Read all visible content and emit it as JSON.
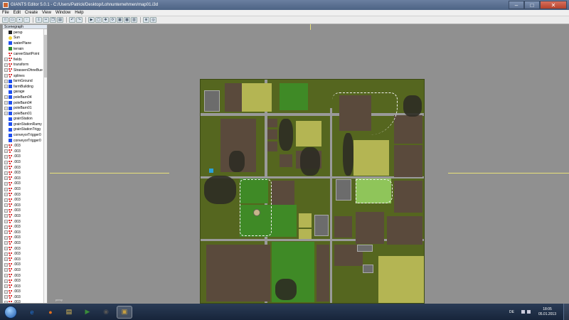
{
  "window": {
    "title": "GIANTS Editor 5.0.1 - C:/Users/Patrick/Desktop/Lohnunternehmen/map01.i3d"
  },
  "menu": [
    "File",
    "Edit",
    "Create",
    "View",
    "Window",
    "Help"
  ],
  "toolbar": {
    "icons": [
      "new-icon",
      "open-icon",
      "save-icon",
      "save-as-icon",
      "import-icon",
      "cut-icon",
      "copy-icon",
      "paste-icon",
      "undo-icon",
      "redo-icon",
      "play-icon",
      "select-icon",
      "move-icon",
      "rotate-icon",
      "terrain-paint-icon",
      "foliage-icon",
      "texture-icon",
      "zoom-icon",
      "camera-icon"
    ]
  },
  "scenegraph": {
    "header": "Scenegraph",
    "nodes": [
      {
        "label": "persp",
        "icon": "camera-icon",
        "expand": false
      },
      {
        "label": "Sun",
        "icon": "light-icon",
        "expand": false
      },
      {
        "label": "waterPlane",
        "icon": "shape-icon",
        "expand": false
      },
      {
        "label": "terrain",
        "icon": "terrain-icon",
        "expand": false
      },
      {
        "label": "careerStartPoint",
        "icon": "transform-icon",
        "expand": false
      },
      {
        "label": "fields",
        "icon": "transform-icon",
        "expand": true
      },
      {
        "label": "transform",
        "icon": "transform-icon",
        "expand": true
      },
      {
        "label": "StrassenOhneBue",
        "icon": "transform-icon",
        "expand": true
      },
      {
        "label": "splines",
        "icon": "transform-icon",
        "expand": true
      },
      {
        "label": "farmGround",
        "icon": "shape-icon",
        "expand": true
      },
      {
        "label": "farmBuilding",
        "icon": "shape-icon",
        "expand": true
      },
      {
        "label": "garage",
        "icon": "shape-icon",
        "expand": false
      },
      {
        "label": "poleBarn04",
        "icon": "shape-icon",
        "expand": true
      },
      {
        "label": "poleBarn04",
        "icon": "shape-icon",
        "expand": true
      },
      {
        "label": "poleBarn01",
        "icon": "shape-icon",
        "expand": true
      },
      {
        "label": "poleBarn01",
        "icon": "shape-icon",
        "expand": true
      },
      {
        "label": "grainStation",
        "icon": "shape-icon",
        "expand": false
      },
      {
        "label": "grainStationRamy",
        "icon": "shape-icon",
        "expand": false
      },
      {
        "label": "grainStationTrigg",
        "icon": "shape-icon",
        "expand": false
      },
      {
        "label": "conveyorTrigger0",
        "icon": "shape-icon",
        "expand": false
      },
      {
        "label": "conveyorTrigger0",
        "icon": "shape-icon",
        "expand": false
      },
      {
        "label": ".003",
        "icon": "transform-icon",
        "expand": true
      },
      {
        "label": ".003",
        "icon": "transform-icon",
        "expand": true
      },
      {
        "label": ".003",
        "icon": "transform-icon",
        "expand": true
      },
      {
        "label": ".003",
        "icon": "transform-icon",
        "expand": true
      },
      {
        "label": ".003",
        "icon": "transform-icon",
        "expand": true
      },
      {
        "label": ".003",
        "icon": "transform-icon",
        "expand": true
      },
      {
        "label": ".003",
        "icon": "transform-icon",
        "expand": true
      },
      {
        "label": ".003",
        "icon": "transform-icon",
        "expand": true
      },
      {
        "label": ".003",
        "icon": "transform-icon",
        "expand": true
      },
      {
        "label": ".003",
        "icon": "transform-icon",
        "expand": true
      },
      {
        "label": ".003",
        "icon": "transform-icon",
        "expand": true
      },
      {
        "label": ".003",
        "icon": "transform-icon",
        "expand": true
      },
      {
        "label": ".003",
        "icon": "transform-icon",
        "expand": true
      },
      {
        "label": ".003",
        "icon": "transform-icon",
        "expand": true
      },
      {
        "label": ".003",
        "icon": "transform-icon",
        "expand": true
      },
      {
        "label": ".003",
        "icon": "transform-icon",
        "expand": true
      },
      {
        "label": ".003",
        "icon": "transform-icon",
        "expand": true
      },
      {
        "label": ".003",
        "icon": "transform-icon",
        "expand": true
      },
      {
        "label": ".003",
        "icon": "transform-icon",
        "expand": true
      },
      {
        "label": ".003",
        "icon": "transform-icon",
        "expand": true
      },
      {
        "label": ".003",
        "icon": "transform-icon",
        "expand": true
      },
      {
        "label": ".003",
        "icon": "transform-icon",
        "expand": true
      },
      {
        "label": ".003",
        "icon": "transform-icon",
        "expand": true
      },
      {
        "label": ".003",
        "icon": "transform-icon",
        "expand": true
      },
      {
        "label": ".003",
        "icon": "transform-icon",
        "expand": true
      },
      {
        "label": ".003",
        "icon": "transform-icon",
        "expand": true
      },
      {
        "label": ".003",
        "icon": "transform-icon",
        "expand": true
      },
      {
        "label": ".003",
        "icon": "transform-icon",
        "expand": true
      },
      {
        "label": ".003",
        "icon": "transform-icon",
        "expand": true
      },
      {
        "label": ".003",
        "icon": "transform-icon",
        "expand": true
      },
      {
        "label": ".003",
        "icon": "transform-icon",
        "expand": true
      }
    ]
  },
  "viewport": {
    "scale_label": "persp"
  },
  "taskbar": {
    "apps": [
      {
        "name": "ie-icon",
        "glyph": "e",
        "active": false
      },
      {
        "name": "firefox-icon",
        "glyph": "●",
        "active": false
      },
      {
        "name": "explorer-icon",
        "glyph": "▤",
        "active": false
      },
      {
        "name": "media-player-icon",
        "glyph": "▶",
        "active": false
      },
      {
        "name": "steam-icon",
        "glyph": "◉",
        "active": false
      },
      {
        "name": "giants-editor-icon",
        "glyph": "▣",
        "active": true
      }
    ],
    "lang": "DE",
    "time": "18:05",
    "date": "05.01.2013"
  },
  "colors": {
    "titlebar": "#4d6384",
    "viewport": "#909090",
    "axis": "#e8e07a",
    "grass": "#55661f"
  }
}
